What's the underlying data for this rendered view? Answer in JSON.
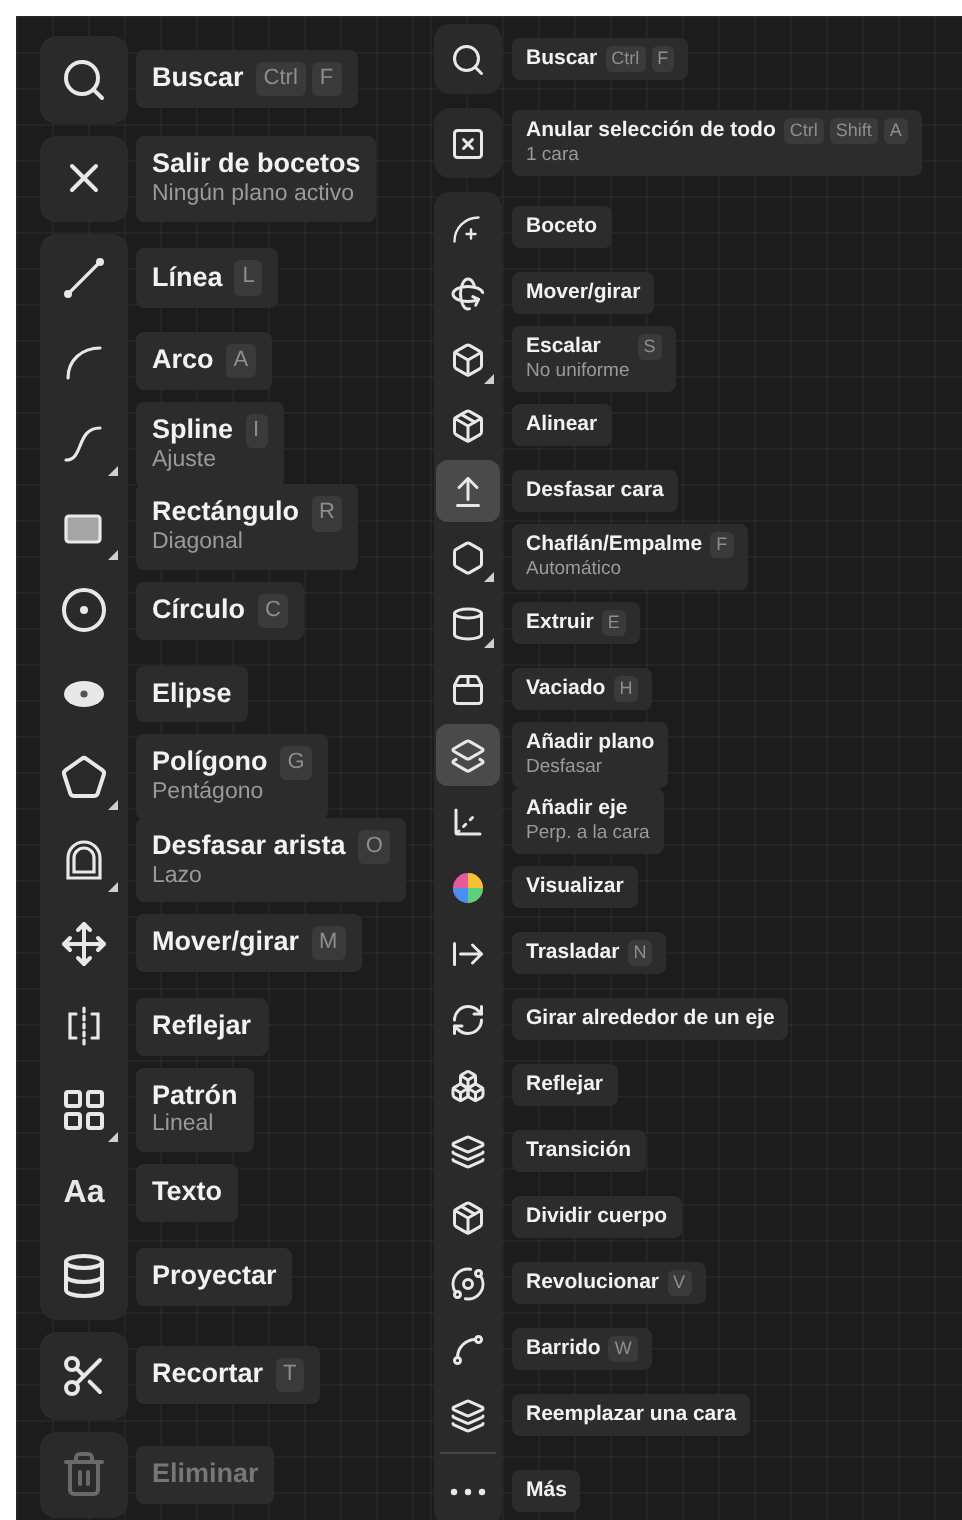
{
  "panels": [
    {
      "groups": [
        {
          "items": [
            {
              "label": "Buscar",
              "keys": [
                "Ctrl",
                "F"
              ],
              "submenu": false,
              "disabled": false
            }
          ]
        },
        {
          "items": [
            {
              "label": "Salir de bocetos",
              "sublabel": "Ningún plano activo",
              "submenu": false,
              "disabled": false
            }
          ]
        },
        {
          "items": [
            {
              "label": "Línea",
              "keys": [
                "L"
              ],
              "submenu": false,
              "disabled": false
            },
            {
              "label": "Arco",
              "keys": [
                "A"
              ],
              "submenu": false,
              "disabled": false
            },
            {
              "label": "Spline",
              "sublabel": "Ajuste",
              "keys": [
                "I"
              ],
              "submenu": true,
              "disabled": false
            },
            {
              "label": "Rectángulo",
              "sublabel": "Diagonal",
              "keys": [
                "R"
              ],
              "submenu": true,
              "disabled": false
            },
            {
              "label": "Círculo",
              "keys": [
                "C"
              ],
              "submenu": false,
              "disabled": false
            },
            {
              "label": "Elipse",
              "submenu": false,
              "disabled": false
            },
            {
              "label": "Polígono",
              "sublabel": "Pentágono",
              "keys": [
                "G"
              ],
              "submenu": true,
              "disabled": false
            },
            {
              "label": "Desfasar arista",
              "sublabel": "Lazo",
              "keys": [
                "O"
              ],
              "submenu": true,
              "disabled": false
            },
            {
              "label": "Mover/girar",
              "keys": [
                "M"
              ],
              "submenu": false,
              "disabled": false
            },
            {
              "label": "Reflejar",
              "submenu": false,
              "disabled": false
            },
            {
              "label": "Patrón",
              "sublabel": "Lineal",
              "submenu": true,
              "disabled": false
            },
            {
              "label": "Texto",
              "icon_text": "Aa",
              "submenu": false,
              "disabled": false
            },
            {
              "label": "Proyectar",
              "submenu": false,
              "disabled": false
            }
          ]
        },
        {
          "items": [
            {
              "label": "Recortar",
              "keys": [
                "T"
              ],
              "submenu": false,
              "disabled": false
            }
          ]
        },
        {
          "items": [
            {
              "label": "Eliminar",
              "submenu": false,
              "disabled": true
            }
          ]
        }
      ]
    },
    {
      "groups": [
        {
          "items": [
            {
              "label": "Buscar",
              "keys": [
                "Ctrl",
                "F"
              ],
              "selected": false,
              "submenu": false
            }
          ]
        },
        {
          "items": [
            {
              "label": "Anular selección de todo",
              "sublabel": "1 cara",
              "keys": [
                "Ctrl",
                "Shift",
                "A"
              ],
              "selected": false,
              "submenu": false
            }
          ]
        },
        {
          "items": [
            {
              "label": "Boceto",
              "selected": false,
              "submenu": false
            },
            {
              "label": "Mover/girar",
              "selected": false,
              "submenu": false
            },
            {
              "label": "Escalar",
              "sublabel": "No uniforme",
              "keys": [
                "S"
              ],
              "selected": false,
              "submenu": true
            },
            {
              "label": "Alinear",
              "selected": false,
              "submenu": false
            },
            {
              "label": "Desfasar cara",
              "selected": true,
              "submenu": false
            },
            {
              "label": "Chaflán/Empalme",
              "sublabel": "Automático",
              "keys": [
                "F"
              ],
              "selected": false,
              "submenu": true
            },
            {
              "label": "Extruir",
              "keys": [
                "E"
              ],
              "selected": false,
              "submenu": true
            },
            {
              "label": "Vaciado",
              "keys": [
                "H"
              ],
              "selected": false,
              "submenu": false
            },
            {
              "label": "Añadir plano",
              "sublabel": "Desfasar",
              "selected": true,
              "submenu": false
            },
            {
              "label": "Añadir eje",
              "sublabel": "Perp. a la cara",
              "selected": false,
              "submenu": false
            },
            {
              "label": "Visualizar",
              "selected": false,
              "submenu": false
            },
            {
              "label": "Trasladar",
              "keys": [
                "N"
              ],
              "selected": false,
              "submenu": false
            },
            {
              "label": "Girar alrededor de un eje",
              "selected": false,
              "submenu": false
            },
            {
              "label": "Reflejar",
              "selected": false,
              "submenu": false
            },
            {
              "label": "Transición",
              "selected": false,
              "submenu": false
            },
            {
              "label": "Dividir cuerpo",
              "selected": false,
              "submenu": false
            },
            {
              "label": "Revolucionar",
              "keys": [
                "V"
              ],
              "selected": false,
              "submenu": false
            },
            {
              "label": "Barrido",
              "keys": [
                "W"
              ],
              "selected": false,
              "submenu": false
            },
            {
              "label": "Reemplazar una cara",
              "selected": false,
              "submenu": false
            },
            {
              "label": "Más",
              "separated": true,
              "selected": false,
              "submenu": false
            }
          ]
        }
      ]
    }
  ]
}
